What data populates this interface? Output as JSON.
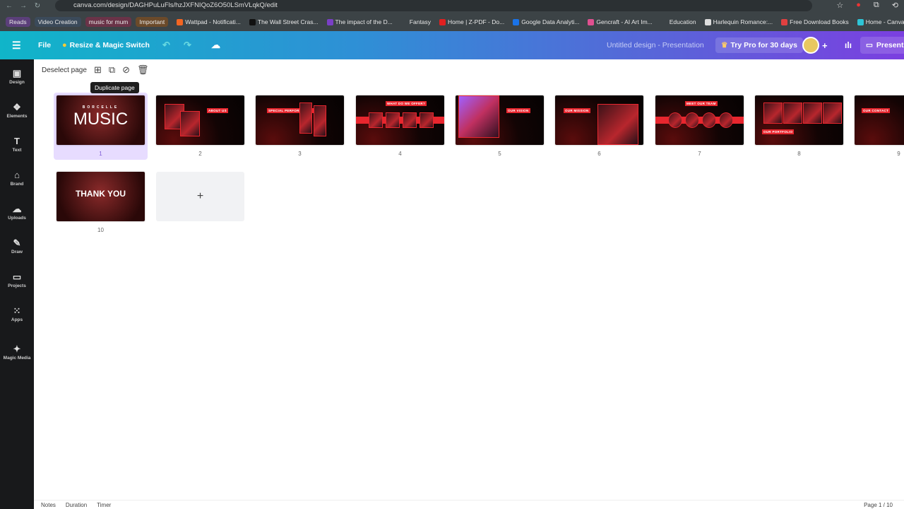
{
  "browser": {
    "url": "canva.com/design/DAGHPuLuFls/hzJXFNIQoZ6O50LSmVLqkQ/edit",
    "bookmarks_chips": [
      {
        "label": "Reads",
        "color": "#5b3f7a"
      },
      {
        "label": "Video Creation",
        "color": "#3b4a5a"
      },
      {
        "label": "music for mum",
        "color": "#6a3348"
      },
      {
        "label": "Important",
        "color": "#6b4a2a"
      }
    ],
    "bookmarks": [
      {
        "label": "Wattpad - Notificati...",
        "color": "#f26522"
      },
      {
        "label": "The Wall Street Cras...",
        "color": "#111111"
      },
      {
        "label": "The impact of the D...",
        "color": "#7a3fc6"
      },
      {
        "label": "Fantasy",
        "color": "#3c4346"
      },
      {
        "label": "Home | Z-PDF - Do...",
        "color": "#e02020"
      },
      {
        "label": "Google Data Analyti...",
        "color": "#1a73e8"
      },
      {
        "label": "Gencraft - AI Art Im...",
        "color": "#e05090"
      },
      {
        "label": "Education",
        "color": "#3c4346"
      },
      {
        "label": "Harlequin Romance:...",
        "color": "#dddddd"
      },
      {
        "label": "Free Download Books",
        "color": "#e04040"
      },
      {
        "label": "Home - Canva",
        "color": "#2ec4d6"
      }
    ]
  },
  "topbar": {
    "file": "File",
    "resize": "Resize & Magic Switch",
    "title": "Untitled design - Presentation",
    "try_pro": "Try Pro for 30 days",
    "present": "Present"
  },
  "sidebar": [
    {
      "label": "Design",
      "icon": "▣"
    },
    {
      "label": "Elements",
      "icon": "❖"
    },
    {
      "label": "Text",
      "icon": "T"
    },
    {
      "label": "Brand",
      "icon": "⌂"
    },
    {
      "label": "Uploads",
      "icon": "☁"
    },
    {
      "label": "Draw",
      "icon": "✎"
    },
    {
      "label": "Projects",
      "icon": "▭"
    },
    {
      "label": "Apps",
      "icon": "⁙"
    },
    {
      "label": "Magic Media",
      "icon": "✦"
    }
  ],
  "toolbar": {
    "deselect": "Deselect page",
    "tooltip": "Duplicate page"
  },
  "pages": [
    {
      "num": "1",
      "title": "MUSIC",
      "sub": "BORCELLE"
    },
    {
      "num": "2",
      "title": "ABOUT US"
    },
    {
      "num": "3",
      "title": "SPECIAL PERFORMANCE"
    },
    {
      "num": "4",
      "title": "WHAT DO WE OFFER?"
    },
    {
      "num": "5",
      "title": "OUR VISION"
    },
    {
      "num": "6",
      "title": "OUR MISSION"
    },
    {
      "num": "7",
      "title": "MEET OUR TEAM"
    },
    {
      "num": "8",
      "title": "OUR PORTFOLIO"
    },
    {
      "num": "9",
      "title": "OUR CONTACT"
    },
    {
      "num": "10",
      "title": "THANK YOU"
    }
  ],
  "add_page": "+",
  "footer": {
    "notes": "Notes",
    "duration": "Duration",
    "timer": "Timer",
    "page": "Page 1 / 10"
  },
  "accent": "#e8262e"
}
